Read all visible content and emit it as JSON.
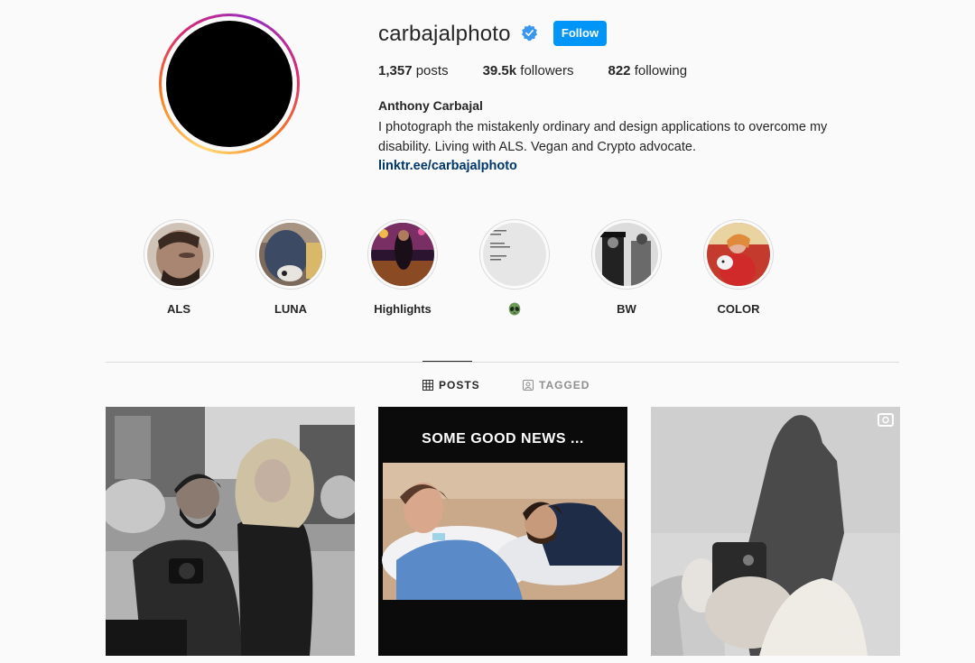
{
  "profile": {
    "username": "carbajalphoto",
    "follow_label": "Follow",
    "stats": {
      "posts_count": "1,357",
      "posts_label": "posts",
      "followers_count": "39.5k",
      "followers_label": "followers",
      "following_count": "822",
      "following_label": "following"
    },
    "full_name": "Anthony Carbajal",
    "bio_line1": "I photograph the mistakenly ordinary and design applications to overcome my",
    "bio_line2": "disability. Living with ALS. Vegan and Crypto advocate.",
    "link": "linktr.ee/carbajalphoto"
  },
  "highlights": [
    {
      "label": "ALS"
    },
    {
      "label": "LUNA"
    },
    {
      "label": "Highlights"
    },
    {
      "label": "👽"
    },
    {
      "label": "BW"
    },
    {
      "label": "COLOR"
    }
  ],
  "tabs": {
    "posts": "POSTS",
    "tagged": "TAGGED"
  },
  "posts": [
    {
      "type": "photo"
    },
    {
      "type": "photo",
      "overlay_text": "SOME GOOD NEWS ..."
    },
    {
      "type": "video"
    }
  ],
  "colors": {
    "accent": "#0095f6",
    "link": "#00376b",
    "verified": "#3897f0"
  }
}
